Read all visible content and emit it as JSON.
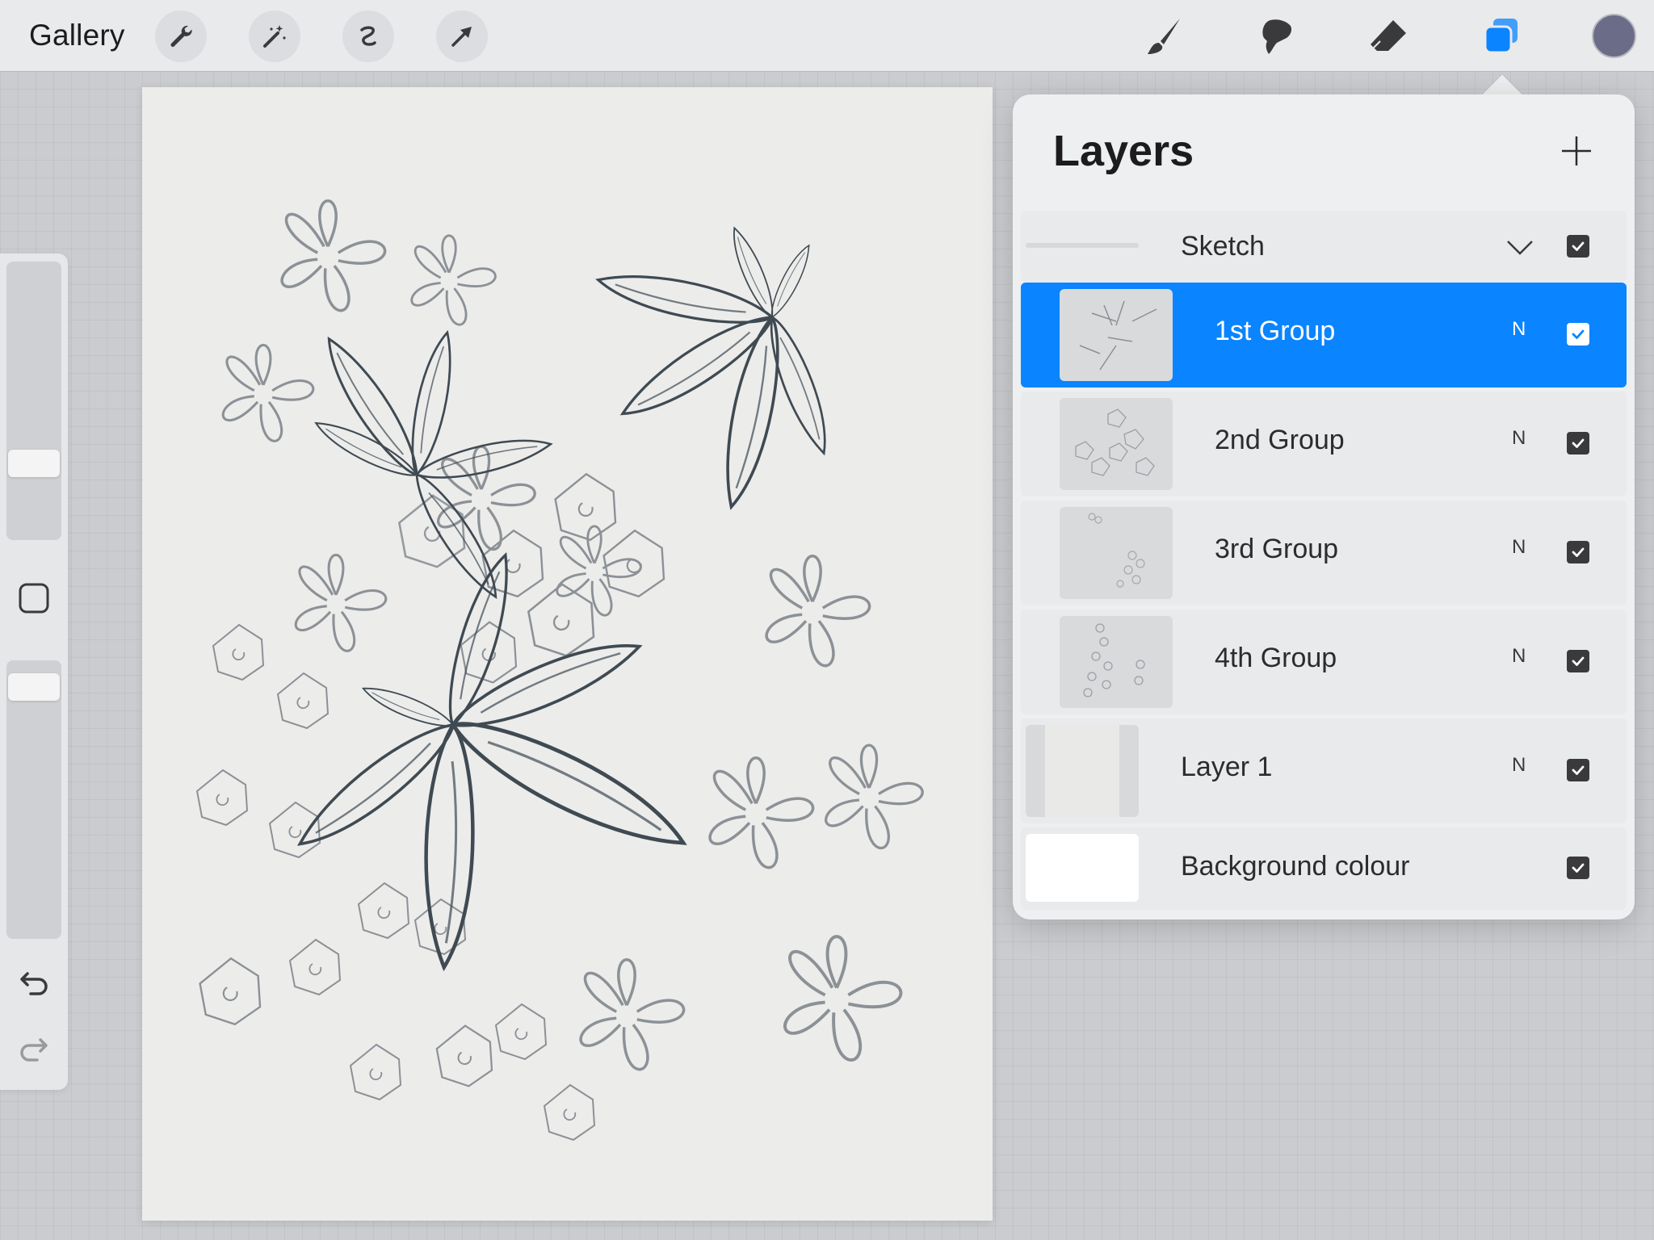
{
  "topbar": {
    "gallery_label": "Gallery",
    "left_tools": [
      "wrench-icon",
      "magic-wand-icon",
      "selection-icon",
      "transform-arrow-icon"
    ],
    "right_tools": [
      "brush-icon",
      "smudge-icon",
      "eraser-icon",
      "layers-icon"
    ],
    "active_tool": "layers-icon",
    "current_color": "#6b6d88",
    "accent_color": "#0a84ff"
  },
  "sidebar": {
    "brush_size_level": 0.25,
    "opacity_level": 0.95,
    "icons": [
      "modify-square-icon",
      "undo-icon",
      "redo-icon"
    ]
  },
  "layers": {
    "title": "Layers",
    "add_icon": "plus-icon",
    "group": {
      "name": "Sketch",
      "collapsed_icon": "chevron-down-icon",
      "visible": true
    },
    "items": [
      {
        "name": "1st Group",
        "blend": "N",
        "visible": true,
        "selected": true
      },
      {
        "name": "2nd Group",
        "blend": "N",
        "visible": true,
        "selected": false
      },
      {
        "name": "3rd Group",
        "blend": "N",
        "visible": true,
        "selected": false
      },
      {
        "name": "4th Group",
        "blend": "N",
        "visible": true,
        "selected": false
      },
      {
        "name": "Layer 1",
        "blend": "N",
        "visible": true,
        "selected": false
      }
    ],
    "background": {
      "name": "Background colour",
      "color": "#ffffff",
      "visible": true
    }
  }
}
